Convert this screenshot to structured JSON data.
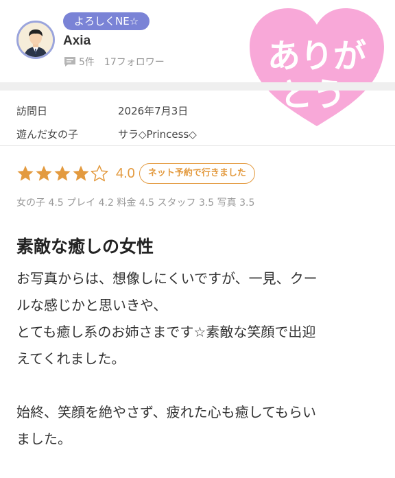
{
  "profile": {
    "tag": "よろしくNE☆",
    "username": "Axia",
    "review_count": "5件",
    "followers": "17フォロワー",
    "avatar_icon": "user-avatar-icon",
    "comment_icon": "comment-icon"
  },
  "sticker": {
    "text_line1": "ありが",
    "text_line2": "とう",
    "color": "#f8a8d8"
  },
  "info": {
    "visit_label": "訪問日",
    "visit_value": "2026年7月3日",
    "girl_label": "遊んだ女の子",
    "girl_value": "サラ◇Princess◇"
  },
  "rating": {
    "stars": 4,
    "max_stars": 5,
    "score": "4.0",
    "badge": "ネット予約で行きました",
    "accent_color": "#e39a3f"
  },
  "subscores": "女の子 4.5 プレイ 4.2 料金 4.5 スタッフ 3.5 写真 3.5",
  "review": {
    "title": "素敵な癒しの女性",
    "lines": [
      "お写真からは、想像しにくいですが、一見、クー",
      "ルな感じかと思いきや、",
      "とても癒し系のお姉さまです☆素敵な笑顔で出迎",
      "えてくれました。",
      "",
      "始終、笑顔を絶やさず、疲れた心も癒してもらい",
      "ました。"
    ]
  }
}
